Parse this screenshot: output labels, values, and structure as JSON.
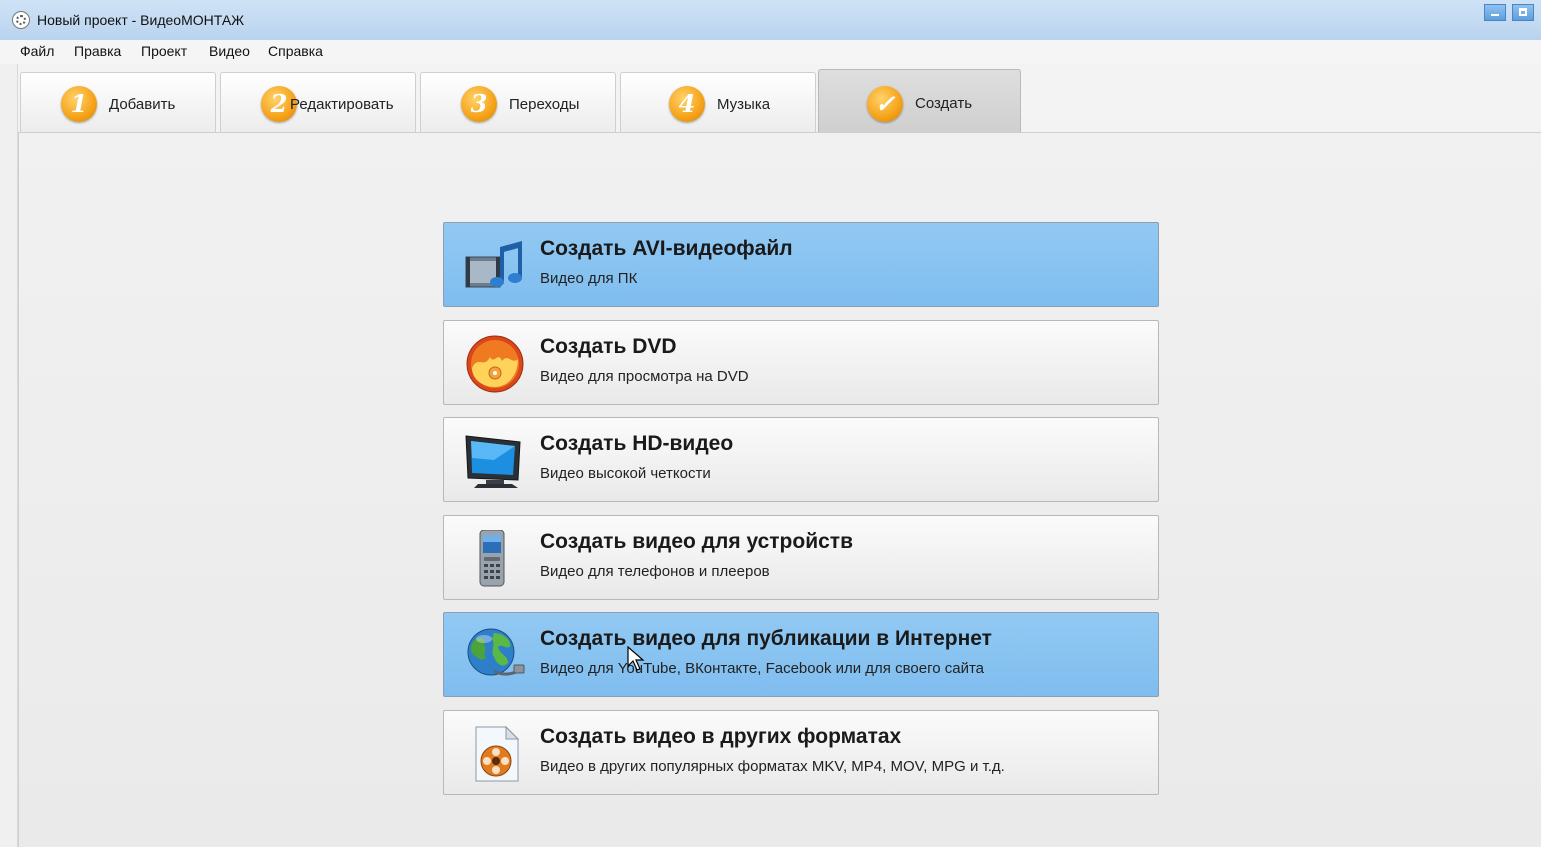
{
  "window": {
    "title": "Новый проект - ВидеоМОНТАЖ"
  },
  "menu": [
    "Файл",
    "Правка",
    "Проект",
    "Видео",
    "Справка"
  ],
  "tabs": [
    {
      "num": "1",
      "label": "Добавить",
      "icon": "number-1-badge"
    },
    {
      "num": "2",
      "label": "Редактировать",
      "icon": "number-2-badge"
    },
    {
      "num": "3",
      "label": "Переходы",
      "icon": "number-3-badge"
    },
    {
      "num": "4",
      "label": "Музыка",
      "icon": "number-4-badge"
    },
    {
      "num": "✓",
      "label": "Создать",
      "icon": "checkmark-badge",
      "active": true
    }
  ],
  "options": [
    {
      "title": "Создать AVI-видеофайл",
      "desc": "Видео для ПК",
      "icon": "film-music-icon",
      "selected": true
    },
    {
      "title": "Создать DVD",
      "desc": "Видео для просмотра на DVD",
      "icon": "dvd-disc-icon",
      "selected": false
    },
    {
      "title": "Создать HD-видео",
      "desc": "Видео высокой четкости",
      "icon": "hd-monitor-icon",
      "selected": false
    },
    {
      "title": "Создать видео для устройств",
      "desc": "Видео для телефонов и плееров",
      "icon": "mobile-phone-icon",
      "selected": false
    },
    {
      "title": "Создать видео для публикации в Интернет",
      "desc": "Видео для YouTube, ВКонтакте, Facebook или для своего сайта",
      "icon": "globe-icon",
      "selected": true
    },
    {
      "title": "Создать видео в других форматах",
      "desc": "Видео в других популярных форматах MKV, MP4, MOV, MPG и т.д.",
      "icon": "film-reel-file-icon",
      "selected": false
    }
  ],
  "colors": {
    "selected_option": "#8cc6f2",
    "tab_badge": "#f5a21a",
    "titlebar": "#c4dbf2"
  }
}
